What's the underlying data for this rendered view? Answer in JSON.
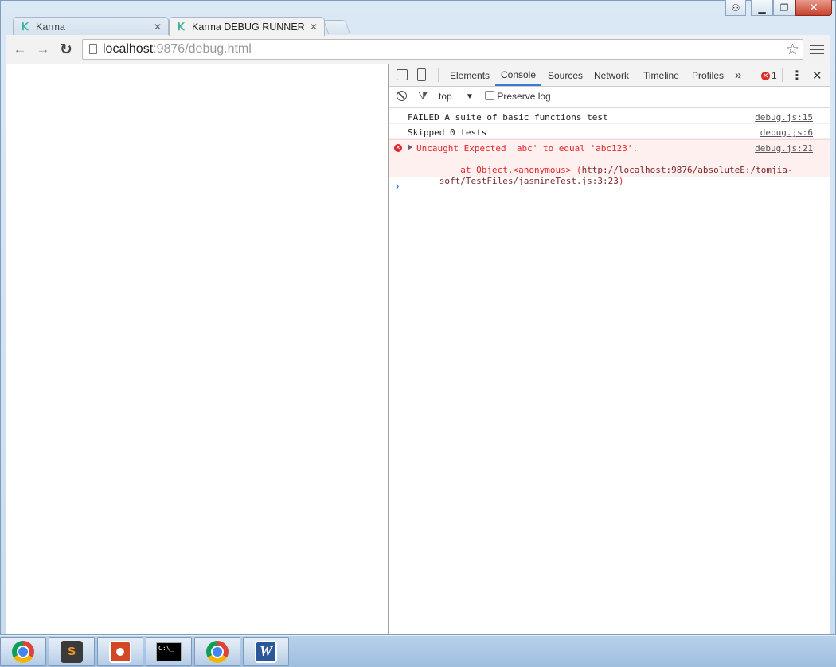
{
  "window": {
    "minimize_label": "▁",
    "maximize_label": "❐",
    "close_label": "✕"
  },
  "tabs": [
    {
      "title": "Karma",
      "close": "✕",
      "icon": "karma-icon"
    },
    {
      "title": "Karma DEBUG RUNNER",
      "close": "✕",
      "icon": "karma-icon"
    }
  ],
  "toolbar": {
    "back": "←",
    "forward": "→",
    "reload": "↻",
    "url_host": "localhost",
    "url_rest": ":9876/debug.html",
    "star": "☆"
  },
  "devtools": {
    "tabs": [
      "Elements",
      "Console",
      "Sources",
      "Network",
      "Timeline",
      "Profiles"
    ],
    "selected_tab": "Console",
    "more": "»",
    "error_count": "1",
    "kebab": "⋮",
    "close": "✕",
    "console_toolbar": {
      "context": "top",
      "context_arrow": "▼",
      "preserve_log": "Preserve log"
    },
    "messages": [
      {
        "text": "FAILED A suite of basic functions test",
        "source": "debug.js:15"
      },
      {
        "text": "Skipped 0 tests",
        "source": "debug.js:6"
      }
    ],
    "error": {
      "line1": "Uncaught Expected 'abc' to equal 'abc123'.",
      "line2_prefix": "    at Object.<anonymous> (",
      "link_part1": "http://localhost:9876/absoluteE:/tomjia-",
      "link_part2": "soft/TestFiles/jasmineTest.js:3:23",
      "line3_suffix": ")",
      "source": "debug.js:21"
    },
    "prompt": "›"
  },
  "taskbar": {
    "apps": [
      "chrome-icon",
      "sublime-text-icon",
      "powerpoint-icon",
      "cmd-icon",
      "chrome-icon",
      "word-icon"
    ],
    "sublime_letter": "S",
    "word_letter": "W",
    "cmd_text": "C:\\_"
  },
  "colors": {
    "accent": "#3879d9",
    "error": "#e0262b",
    "error_bg": "#fff0f0"
  }
}
